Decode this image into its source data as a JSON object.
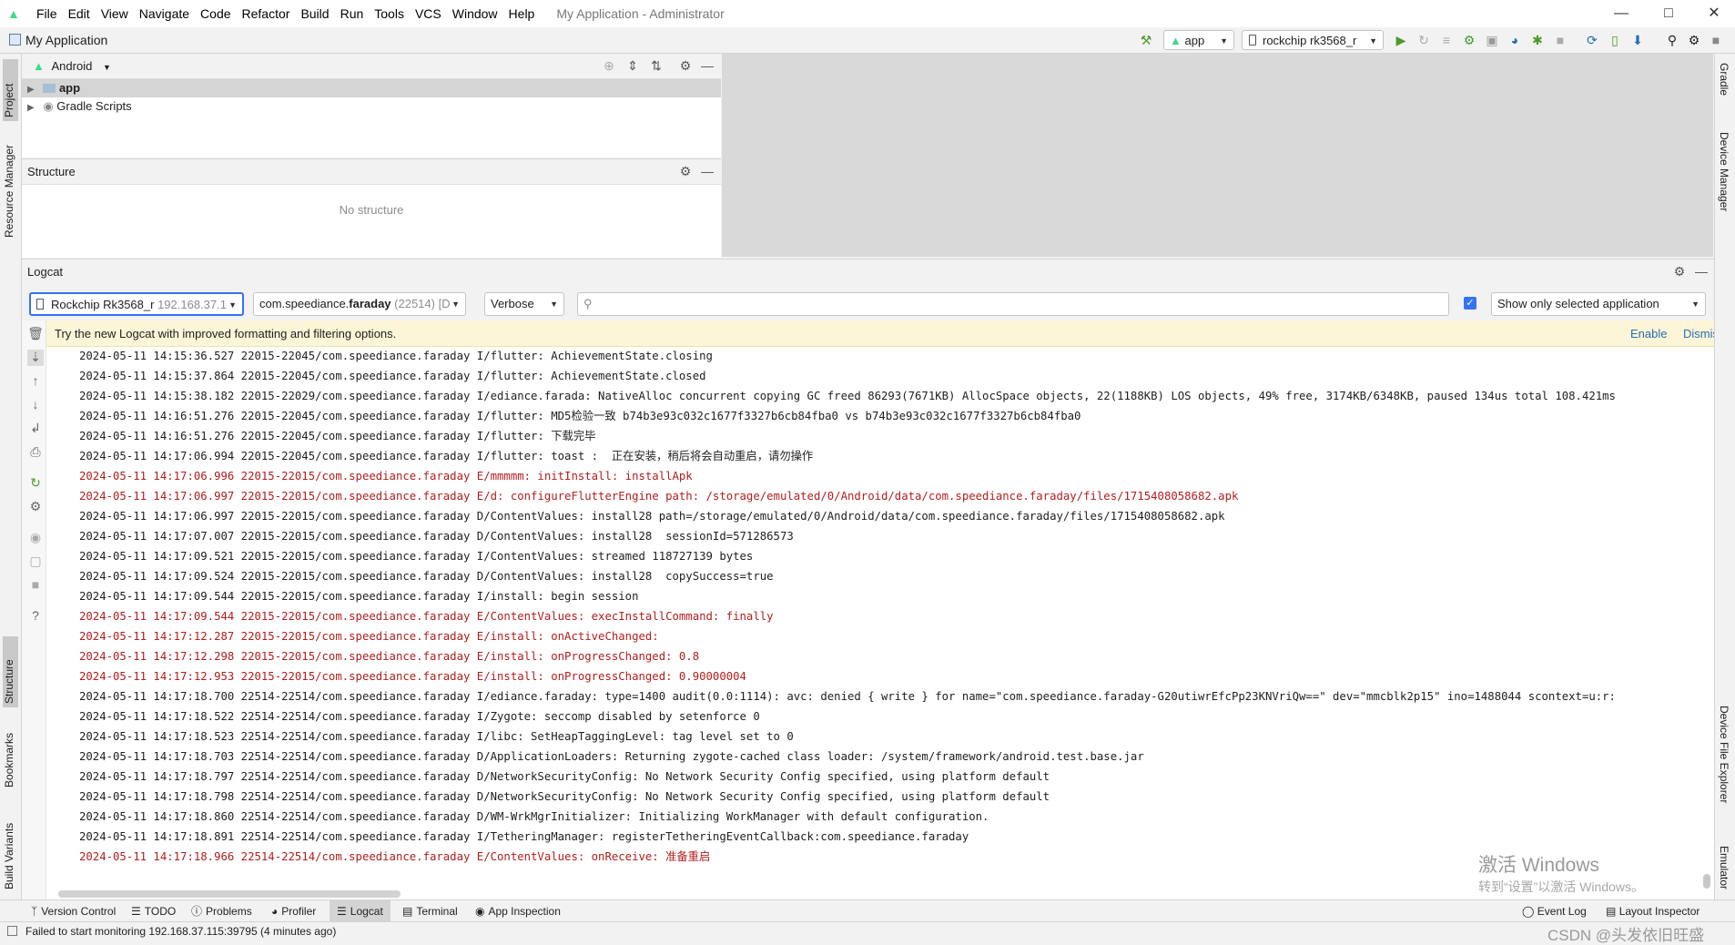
{
  "menu": [
    "File",
    "Edit",
    "View",
    "Navigate",
    "Code",
    "Refactor",
    "Build",
    "Run",
    "Tools",
    "VCS",
    "Window",
    "Help"
  ],
  "window_title": "My Application - Administrator",
  "project_name": "My Application",
  "toolbar": {
    "run_config": "app",
    "device": "rockchip rk3568_r"
  },
  "project_panel": {
    "view_mode": "Android",
    "tree": [
      {
        "label": "app",
        "bold": true
      },
      {
        "label": "Gradle Scripts",
        "bold": false
      }
    ]
  },
  "structure_panel": {
    "title": "Structure",
    "empty_text": "No structure"
  },
  "left_stripe": [
    "Project",
    "Resource Manager",
    "Structure",
    "Bookmarks",
    "Build Variants"
  ],
  "right_stripe": [
    "Gradle",
    "Device Manager",
    "Device File Explorer",
    "Emulator"
  ],
  "logcat": {
    "title": "Logcat",
    "device_name": "Rockchip Rk3568_r",
    "device_ip": "192.168.37.1",
    "package_prefix": "com.speediance.",
    "package_name": "faraday",
    "package_pid": "(22514) [D",
    "level": "Verbose",
    "search_placeholder": "",
    "filter_mode": "Show only selected application",
    "banner_text": "Try the new Logcat with improved formatting and filtering options.",
    "banner_enable": "Enable",
    "banner_dismiss": "Dismiss",
    "lines": [
      {
        "level": "I",
        "text": "2024-05-11 14:15:36.527 22015-22045/com.speediance.faraday I/flutter: AchievementState.closing"
      },
      {
        "level": "I",
        "text": "2024-05-11 14:15:37.864 22015-22045/com.speediance.faraday I/flutter: AchievementState.closed"
      },
      {
        "level": "I",
        "text": "2024-05-11 14:15:38.182 22015-22029/com.speediance.faraday I/ediance.farada: NativeAlloc concurrent copying GC freed 86293(7671KB) AllocSpace objects, 22(1188KB) LOS objects, 49% free, 3174KB/6348KB, paused 134us total 108.421ms"
      },
      {
        "level": "I",
        "text": "2024-05-11 14:16:51.276 22015-22045/com.speediance.faraday I/flutter: MD5检验一致 b74b3e93c032c1677f3327b6cb84fba0 vs b74b3e93c032c1677f3327b6cb84fba0"
      },
      {
        "level": "I",
        "text": "2024-05-11 14:16:51.276 22015-22045/com.speediance.faraday I/flutter: 下载完毕"
      },
      {
        "level": "I",
        "text": "2024-05-11 14:17:06.994 22015-22045/com.speediance.faraday I/flutter: toast :  正在安装，稍后将会自动重启，请勿操作"
      },
      {
        "level": "E",
        "text": "2024-05-11 14:17:06.996 22015-22015/com.speediance.faraday E/mmmmm: initInstall: installApk"
      },
      {
        "level": "E",
        "text": "2024-05-11 14:17:06.997 22015-22015/com.speediance.faraday E/d: configureFlutterEngine path: /storage/emulated/0/Android/data/com.speediance.faraday/files/1715408058682.apk"
      },
      {
        "level": "D",
        "text": "2024-05-11 14:17:06.997 22015-22015/com.speediance.faraday D/ContentValues: install28 path=/storage/emulated/0/Android/data/com.speediance.faraday/files/1715408058682.apk"
      },
      {
        "level": "D",
        "text": "2024-05-11 14:17:07.007 22015-22015/com.speediance.faraday D/ContentValues: install28  sessionId=571286573"
      },
      {
        "level": "I",
        "text": "2024-05-11 14:17:09.521 22015-22015/com.speediance.faraday I/ContentValues: streamed 118727139 bytes"
      },
      {
        "level": "D",
        "text": "2024-05-11 14:17:09.524 22015-22015/com.speediance.faraday D/ContentValues: install28  copySuccess=true"
      },
      {
        "level": "I",
        "text": "2024-05-11 14:17:09.544 22015-22015/com.speediance.faraday I/install: begin session"
      },
      {
        "level": "E",
        "text": "2024-05-11 14:17:09.544 22015-22015/com.speediance.faraday E/ContentValues: execInstallCommand: finally"
      },
      {
        "level": "E",
        "text": "2024-05-11 14:17:12.287 22015-22015/com.speediance.faraday E/install: onActiveChanged:"
      },
      {
        "level": "E",
        "text": "2024-05-11 14:17:12.298 22015-22015/com.speediance.faraday E/install: onProgressChanged: 0.8"
      },
      {
        "level": "E",
        "text": "2024-05-11 14:17:12.953 22015-22015/com.speediance.faraday E/install: onProgressChanged: 0.90000004"
      },
      {
        "level": "I",
        "text": "2024-05-11 14:17:18.700 22514-22514/com.speediance.faraday I/ediance.faraday: type=1400 audit(0.0:1114): avc: denied { write } for name=\"com.speediance.faraday-G20utiwrEfcPp23KNVriQw==\" dev=\"mmcblk2p15\" ino=1488044 scontext=u:r:"
      },
      {
        "level": "I",
        "text": "2024-05-11 14:17:18.522 22514-22514/com.speediance.faraday I/Zygote: seccomp disabled by setenforce 0"
      },
      {
        "level": "I",
        "text": "2024-05-11 14:17:18.523 22514-22514/com.speediance.faraday I/libc: SetHeapTaggingLevel: tag level set to 0"
      },
      {
        "level": "D",
        "text": "2024-05-11 14:17:18.703 22514-22514/com.speediance.faraday D/ApplicationLoaders: Returning zygote-cached class loader: /system/framework/android.test.base.jar"
      },
      {
        "level": "D",
        "text": "2024-05-11 14:17:18.797 22514-22514/com.speediance.faraday D/NetworkSecurityConfig: No Network Security Config specified, using platform default"
      },
      {
        "level": "D",
        "text": "2024-05-11 14:17:18.798 22514-22514/com.speediance.faraday D/NetworkSecurityConfig: No Network Security Config specified, using platform default"
      },
      {
        "level": "D",
        "text": "2024-05-11 14:17:18.860 22514-22514/com.speediance.faraday D/WM-WrkMgrInitializer: Initializing WorkManager with default configuration."
      },
      {
        "level": "I",
        "text": "2024-05-11 14:17:18.891 22514-22514/com.speediance.faraday I/TetheringManager: registerTetheringEventCallback:com.speediance.faraday"
      },
      {
        "level": "E",
        "text": "2024-05-11 14:17:18.966 22514-22514/com.speediance.faraday E/ContentValues: onReceive: 准备重启"
      }
    ]
  },
  "bottom_tabs": [
    {
      "label": "Version Control",
      "icon": "branch-icon",
      "active": false
    },
    {
      "label": "TODO",
      "icon": "list-icon",
      "active": false
    },
    {
      "label": "Problems",
      "icon": "problems-icon",
      "active": false
    },
    {
      "label": "Profiler",
      "icon": "gauge-icon",
      "active": false
    },
    {
      "label": "Logcat",
      "icon": "logcat-icon",
      "active": true
    },
    {
      "label": "Terminal",
      "icon": "terminal-icon",
      "active": false
    },
    {
      "label": "App Inspection",
      "icon": "inspect-icon",
      "active": false
    }
  ],
  "bottom_right_tabs": [
    "Event Log",
    "Layout Inspector"
  ],
  "status_message": "Failed to start monitoring 192.168.37.115:39795 (4 minutes ago)",
  "watermark": {
    "line1": "激活 Windows",
    "line2": "转到“设置”以激活 Windows。",
    "credit": "CSDN @头发依旧旺盛"
  },
  "colors": {
    "accent_green": "#3ddc84",
    "error_red": "#b21d1d",
    "banner_bg": "#fcf5d7",
    "link_blue": "#2470b3",
    "checkbox_blue": "#3574f0"
  }
}
